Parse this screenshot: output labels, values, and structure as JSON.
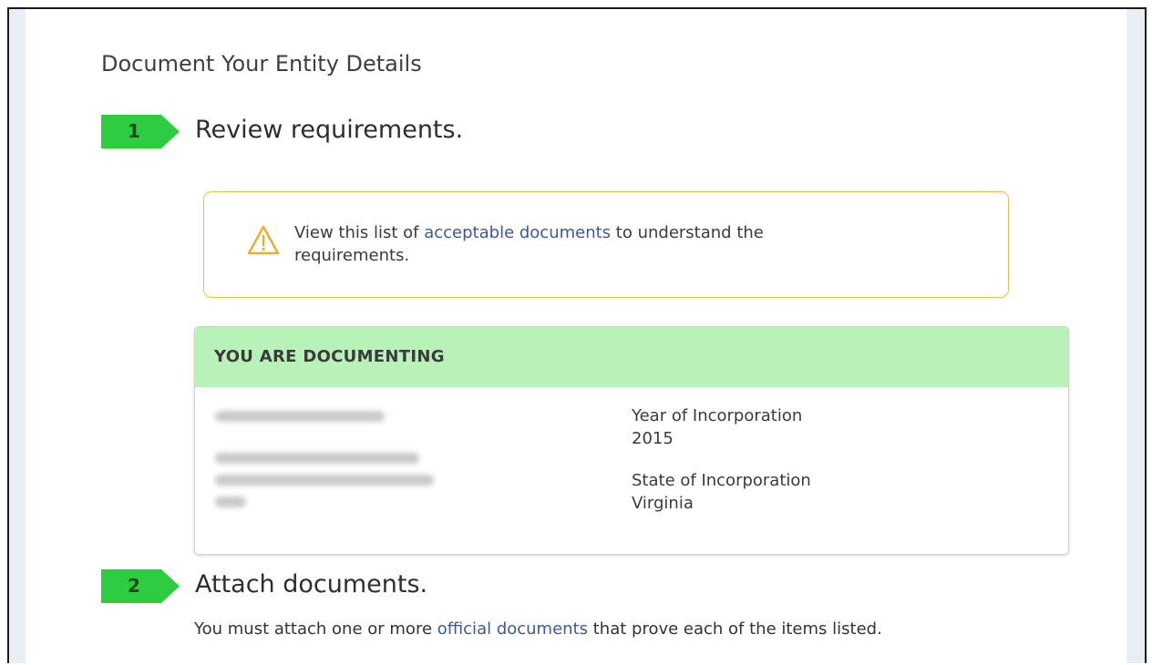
{
  "page": {
    "title": "Document Your Entity Details"
  },
  "steps": [
    {
      "number": "1",
      "heading": "Review requirements."
    },
    {
      "number": "2",
      "heading": "Attach documents."
    }
  ],
  "alert": {
    "icon": "warning-triangle-icon",
    "text_before": "View this list of ",
    "link_text": "acceptable documents",
    "text_after": " to understand the requirements."
  },
  "documenting": {
    "header": "YOU ARE DOCUMENTING",
    "year_label": "Year of Incorporation",
    "year_value": "2015",
    "state_label": "State of Incorporation",
    "state_value": "Virginia"
  },
  "attach": {
    "text_before": "You must attach one or more ",
    "link_text": "official documents",
    "text_after": " that prove each of the items listed."
  },
  "colors": {
    "step_badge": "#2ecc40",
    "card_header": "#b8f2b8",
    "alert_border": "#e8c24a",
    "link": "#3a5a9c"
  }
}
